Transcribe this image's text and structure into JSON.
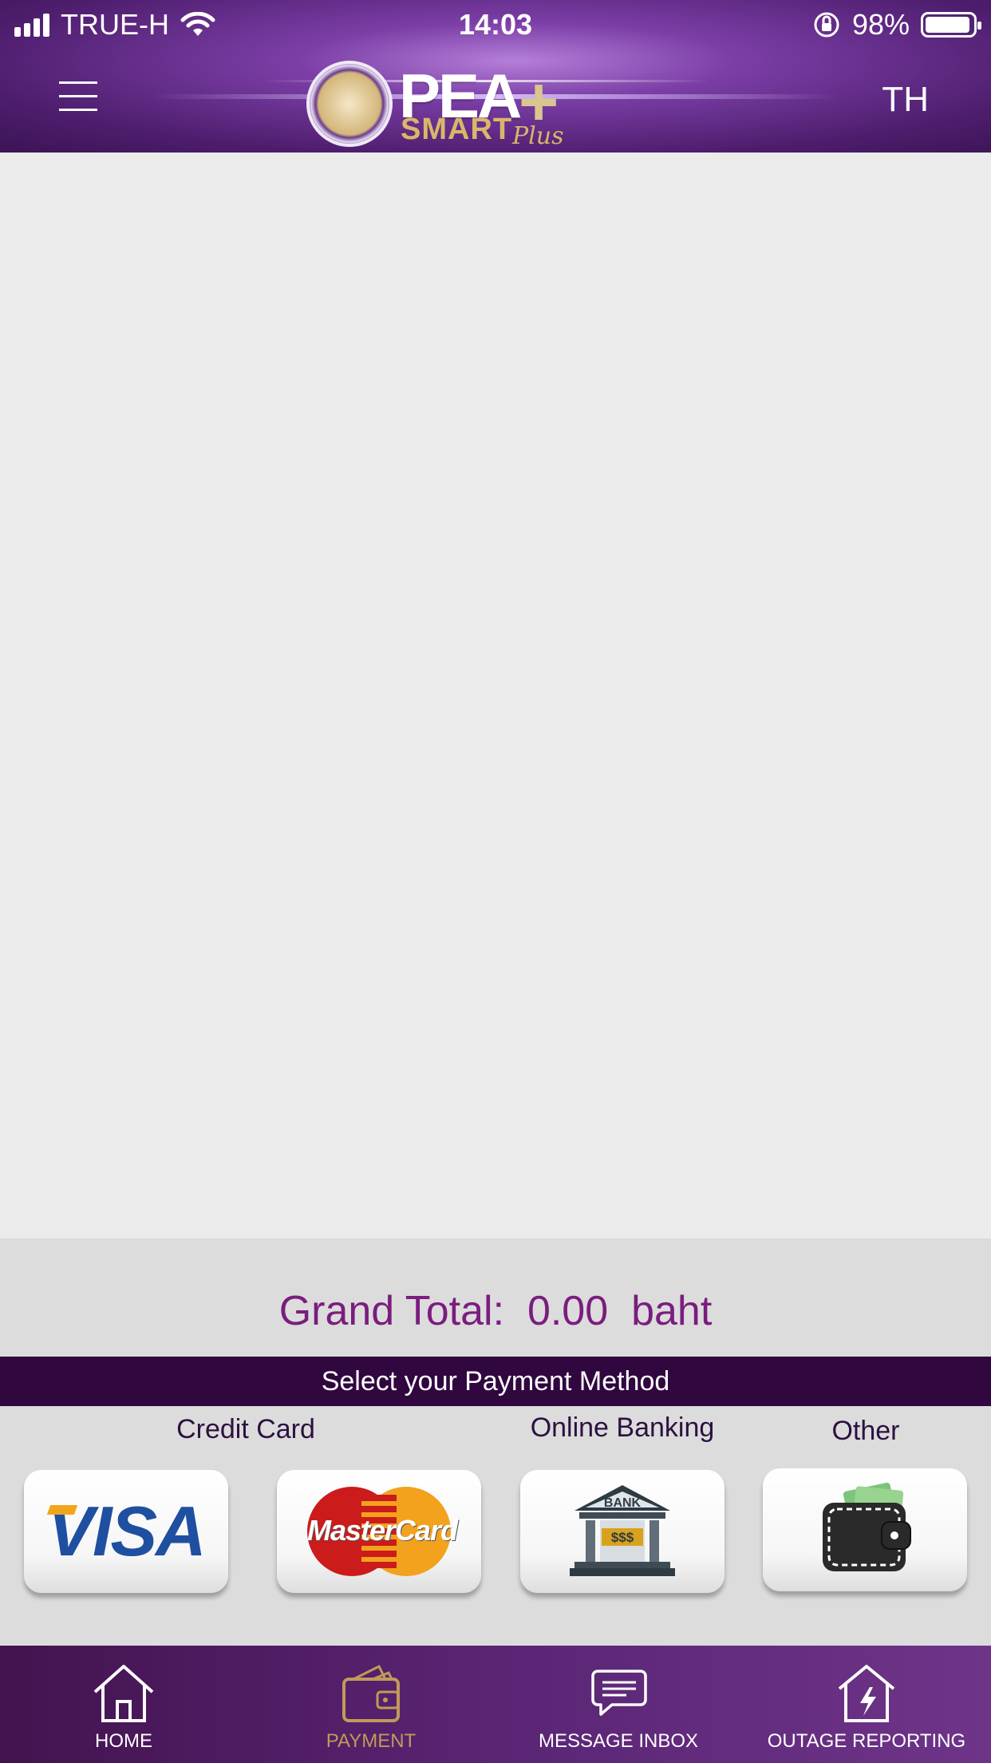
{
  "status_bar": {
    "carrier": "TRUE-H",
    "time": "14:03",
    "battery": "98%"
  },
  "header": {
    "logo_text": "PEA",
    "logo_sub": "SMART",
    "logo_script": "Plus",
    "language_button": "TH"
  },
  "summary": {
    "grand_total_label": "Grand Total:",
    "amount": "0.00",
    "currency": "baht"
  },
  "payment": {
    "heading": "Select your Payment Method",
    "categories": {
      "credit_card": "Credit Card",
      "online_banking": "Online Banking",
      "other": "Other"
    },
    "visa_text": "VISA",
    "mastercard_text": "MasterCard",
    "bank_text": "BANK",
    "bank_money_text": "$$$"
  },
  "tabs": [
    {
      "label": "HOME",
      "icon": "home-icon"
    },
    {
      "label": "PAYMENT",
      "icon": "wallet-icon"
    },
    {
      "label": "MESSAGE INBOX",
      "icon": "chat-icon"
    },
    {
      "label": "OUTAGE REPORTING",
      "icon": "outage-icon"
    }
  ],
  "colors": {
    "header_purple": "#4d1d6d",
    "total_text": "#7a1d7e",
    "select_bar": "#30073f",
    "active_tab": "#c19a58"
  }
}
